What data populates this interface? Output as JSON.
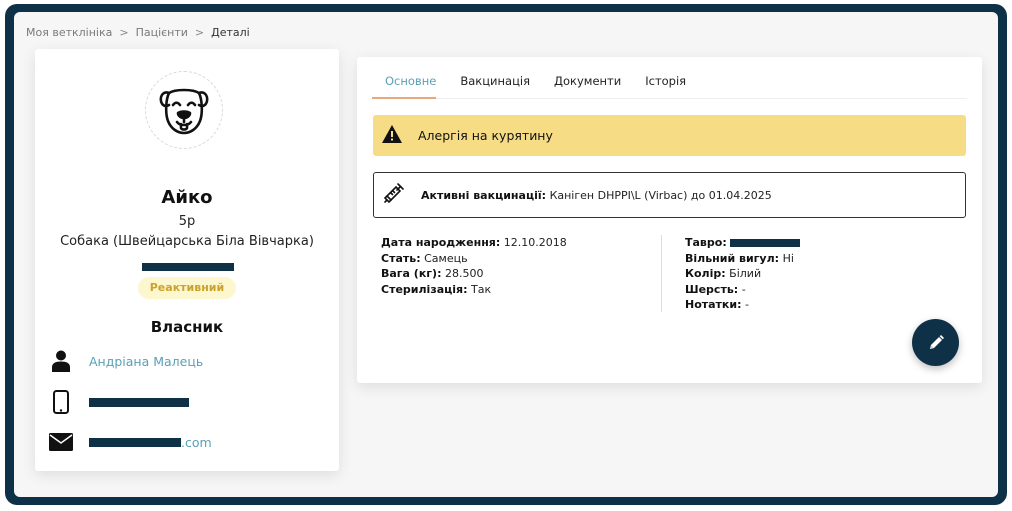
{
  "breadcrumb": {
    "items": [
      "Моя ветклініка",
      "Пацієнти",
      "Деталі"
    ],
    "separator": ">"
  },
  "patient": {
    "avatar_icon": "dog-face-icon",
    "name": "Айко",
    "age": "5р",
    "species_breed": "Собака (Швейцарська Біла Вівчарка)",
    "status": "Реактивний"
  },
  "owner": {
    "title": "Власник",
    "name": "Андріана Малець",
    "email_suffix": ".com"
  },
  "tabs": [
    {
      "label": "Основне",
      "active": true
    },
    {
      "label": "Вакцинація",
      "active": false
    },
    {
      "label": "Документи",
      "active": false
    },
    {
      "label": "Історія",
      "active": false
    }
  ],
  "allergy": {
    "icon": "warning-icon",
    "text": "Алергія на курятину"
  },
  "vaccination": {
    "icon": "syringe-icon",
    "label": "Активні вакцинації:",
    "value": "Каніген DHPPI\\L (Virbac) до 01.04.2025"
  },
  "details_left": [
    {
      "label": "Дата народження:",
      "value": "12.10.2018"
    },
    {
      "label": "Стать:",
      "value": "Самець"
    },
    {
      "label": "Вага (кг):",
      "value": "28.500"
    },
    {
      "label": "Стерилізація:",
      "value": "Так"
    }
  ],
  "details_right": [
    {
      "label": "Тавро:",
      "value": ""
    },
    {
      "label": "Вільний вигул:",
      "value": "Ні"
    },
    {
      "label": "Колір:",
      "value": "Білий"
    },
    {
      "label": "Шерсть:",
      "value": "-"
    },
    {
      "label": "Нотатки:",
      "value": "-"
    }
  ],
  "colors": {
    "frame": "#0f3147",
    "accent": "#5aa0b6",
    "tab_underline": "#e8a87c",
    "allergy_bg": "#f7dc86",
    "badge_bg": "#fdf7cf",
    "badge_text": "#c9a32c"
  }
}
